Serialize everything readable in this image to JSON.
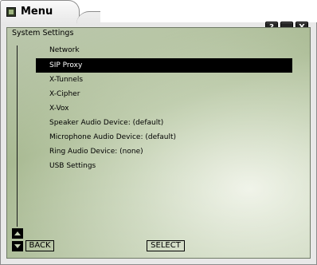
{
  "window": {
    "title": "Menu",
    "controls": {
      "help": "?",
      "minimize": "_",
      "close": "X"
    }
  },
  "panel": {
    "title": "System Settings"
  },
  "menu": {
    "items": [
      {
        "label": "Network",
        "selected": false
      },
      {
        "label": "SIP Proxy",
        "selected": true
      },
      {
        "label": "X-Tunnels",
        "selected": false
      },
      {
        "label": "X-Cipher",
        "selected": false
      },
      {
        "label": "X-Vox",
        "selected": false
      },
      {
        "label": "Speaker Audio Device: (default)",
        "selected": false
      },
      {
        "label": "Microphone Audio Device: (default)",
        "selected": false
      },
      {
        "label": "Ring Audio Device: (none)",
        "selected": false
      },
      {
        "label": "USB Settings",
        "selected": false
      }
    ]
  },
  "softkeys": {
    "back": "BACK",
    "select": "SELECT"
  },
  "colors": {
    "selection_bg": "#000000",
    "selection_fg": "#ffffff",
    "panel_green": "#a9ba93"
  }
}
